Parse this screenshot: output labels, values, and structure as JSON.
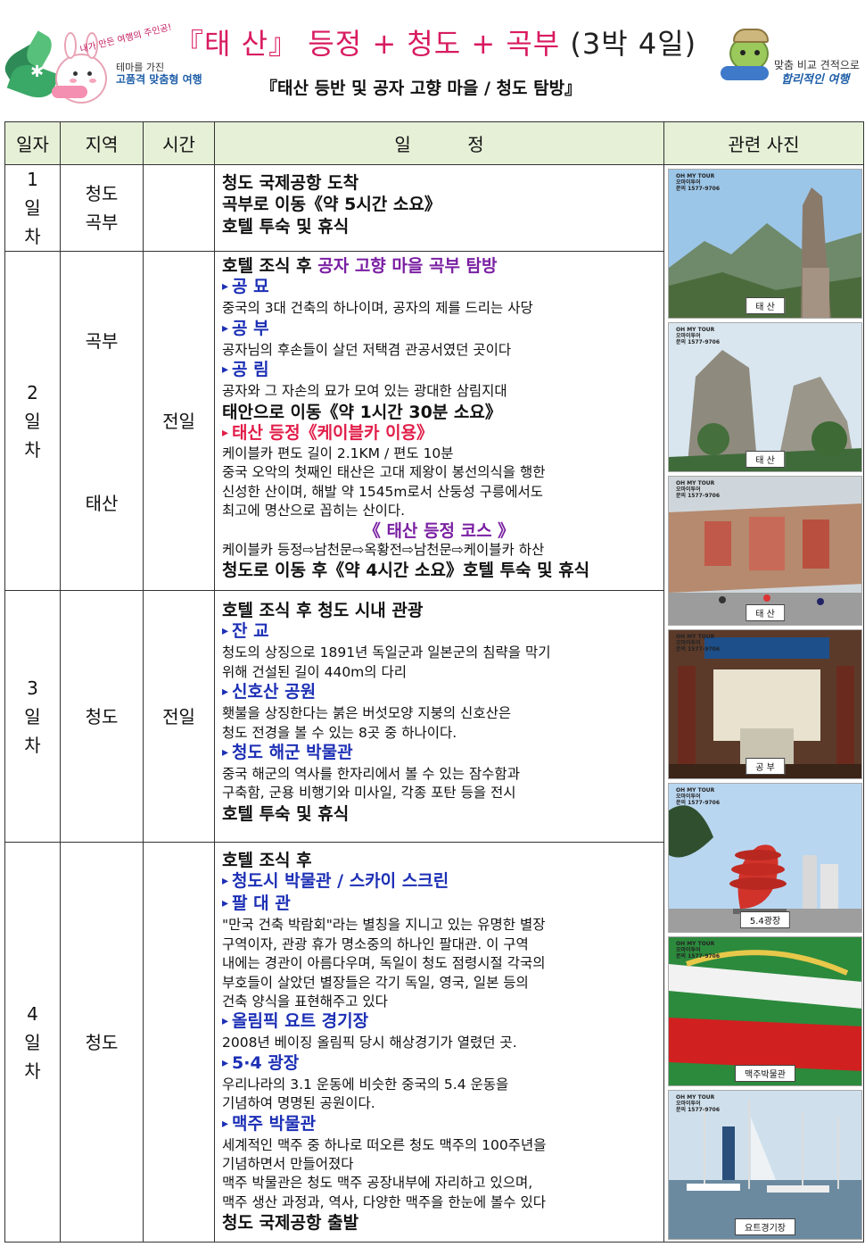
{
  "header": {
    "badge_text": "내가 만든 여행의 주인공!",
    "theme_line1": "테마를 가진",
    "theme_line2": "고품격 맞춤형 여행",
    "title_bracket_open": "『",
    "title_main": "태 산",
    "title_bracket_close": "』",
    "title_rest": "등정 + 청도 + 곡부",
    "title_duration": "(3박 4일)",
    "subtitle": "『태산 등반 및 공자 고향 마을 / 청도 탐방』",
    "right_line1": "맞춤 비교 견적으로",
    "right_line2": "합리적인 여행"
  },
  "table": {
    "headers": {
      "day": "일자",
      "region": "지역",
      "time": "시간",
      "schedule": "일          정",
      "photos": "관련 사진"
    },
    "days": [
      {
        "day": [
          "1",
          "일",
          "차"
        ],
        "regions": [
          "청도",
          "곡부"
        ],
        "time": "",
        "lines": [
          {
            "t": "b",
            "text": "청도 국제공항 도착"
          },
          {
            "t": "b",
            "text": "곡부로 이동《약 5시간 소요》"
          },
          {
            "t": "b",
            "text": "호텔 투숙 및 휴식"
          }
        ]
      },
      {
        "day": [
          "2",
          "일",
          "차"
        ],
        "region_a": "곡부",
        "region_b": "태산",
        "time": "전일",
        "lead_black": "호텔 조식 후 ",
        "lead_purple": "공자 고향 마을 곡부 탐방",
        "lines": [
          {
            "t": "h",
            "text": "공 묘"
          },
          {
            "t": "n",
            "text": "중국의 3대 건축의 하나이며, 공자의 제를 드리는 사당"
          },
          {
            "t": "h",
            "text": "공 부"
          },
          {
            "t": "n",
            "text": "공자님의 후손들이 살던 저택겸 관공서였던 곳이다"
          },
          {
            "t": "h",
            "text": "공 림"
          },
          {
            "t": "n",
            "text": "공자와 그 자손의 묘가 모여 있는 광대한 삼림지대"
          },
          {
            "t": "b",
            "text": "태안으로 이동《약 1시간 30분 소요》"
          },
          {
            "t": "r",
            "text": "태산 등정《케이블카 이용》"
          },
          {
            "t": "n",
            "text": "케이블카 편도 길이 2.1KM / 편도 10분"
          },
          {
            "t": "n",
            "text": "중국 오악의 첫째인 태산은 고대 제왕이 봉선의식을 행한"
          },
          {
            "t": "n",
            "text": "신성한 산이며, 해발 약 1545m로서 산둥성 구릉에서도"
          },
          {
            "t": "n",
            "text": "최고에 명산으로 꼽히는 산이다."
          },
          {
            "t": "ctr",
            "text": "《 태산 등정 코스 》"
          },
          {
            "t": "n",
            "text": "케이블카 등정⇨남천문⇨옥황전⇨남천문⇨케이블카 하산"
          },
          {
            "t": "b",
            "text": "청도로 이동 후《약 4시간 소요》호텔 투숙 및 휴식"
          }
        ]
      },
      {
        "day": [
          "3",
          "일",
          "차"
        ],
        "region": "청도",
        "time": "전일",
        "lines": [
          {
            "t": "b",
            "text": "호텔 조식 후 청도 시내 관광"
          },
          {
            "t": "h",
            "text": "잔 교"
          },
          {
            "t": "n",
            "text": "청도의 상징으로 1891년 독일군과 일본군의 침략을 막기"
          },
          {
            "t": "n",
            "text": "위해 건설된 길이 440m의 다리"
          },
          {
            "t": "h",
            "text": "신호산 공원"
          },
          {
            "t": "n",
            "text": "횃불을 상징한다는 붉은 버섯모양 지붕의 신호산은"
          },
          {
            "t": "n",
            "text": "청도 전경을 볼 수 있는 8곳 중 하나이다."
          },
          {
            "t": "h",
            "text": "청도 해군 박물관"
          },
          {
            "t": "n",
            "text": "중국 해군의 역사를 한자리에서 볼 수 있는 잠수함과"
          },
          {
            "t": "n",
            "text": "구축함, 군용 비행기와 미사일, 각종 포탄 등을 전시"
          },
          {
            "t": "b",
            "text": "호텔 투숙 및 휴식"
          }
        ]
      },
      {
        "day": [
          "4",
          "일",
          "차"
        ],
        "region": "청도",
        "time": "",
        "lines": [
          {
            "t": "b",
            "text": "호텔 조식 후"
          },
          {
            "t": "h",
            "text": "청도시 박물관 / 스카이 스크린"
          },
          {
            "t": "h",
            "text": "팔 대 관"
          },
          {
            "t": "n",
            "text": "\"만국 건축 박람회\"라는 별칭을 지니고 있는 유명한 별장"
          },
          {
            "t": "n",
            "text": "구역이자, 관광 휴가 명소중의 하나인 팔대관. 이 구역"
          },
          {
            "t": "n",
            "text": "내에는 경관이 아름다우며, 독일이 청도 점령시절 각국의"
          },
          {
            "t": "n",
            "text": "부호들이 살았던 별장들은 각기 독일, 영국, 일본 등의"
          },
          {
            "t": "n",
            "text": "건축 양식을 표현해주고 있다"
          },
          {
            "t": "h",
            "text": "올림픽 요트 경기장"
          },
          {
            "t": "n",
            "text": "2008년 베이징 올림픽 당시 해상경기가 열렸던 곳."
          },
          {
            "t": "h",
            "text": "5·4 광장"
          },
          {
            "t": "n",
            "text": "우리나라의 3.1 운동에 비슷한 중국의 5.4 운동을"
          },
          {
            "t": "n",
            "text": "기념하여 명명된 공원이다."
          },
          {
            "t": "h",
            "text": "맥주 박물관"
          },
          {
            "t": "n",
            "text": "세계적인 맥주 중 하나로 떠오른 청도 맥주의 100주년을"
          },
          {
            "t": "n",
            "text": "기념하면서 만들어졌다"
          },
          {
            "t": "n",
            "text": "맥주 박물관은 청도 맥주 공장내부에 자리하고 있으며,"
          },
          {
            "t": "n",
            "text": "맥주 생산 과정과, 역사, 다양한 맥주을 한눈에 볼수 있다"
          },
          {
            "t": "b",
            "text": "청도 국제공항 출발"
          }
        ]
      }
    ]
  },
  "photos": {
    "tag_line1": "OH MY TOUR",
    "tag_line2": "오마이투어",
    "tag_line3": "문의 1577-9706",
    "items": [
      {
        "caption": "태 산",
        "icon": "mountain-peak-photo"
      },
      {
        "caption": "태 산",
        "icon": "rock-cliff-photo"
      },
      {
        "caption": "태 산",
        "icon": "carved-cliff-photo"
      },
      {
        "caption": "공 부",
        "icon": "temple-hall-photo"
      },
      {
        "caption": "5.4광장",
        "icon": "red-sculpture-photo"
      },
      {
        "caption": "맥주박물관",
        "icon": "beer-can-photo"
      },
      {
        "caption": "요트경기장",
        "icon": "yacht-harbor-photo"
      }
    ]
  },
  "colors": {
    "header_bg": "#e6f0d7",
    "title_pink": "#d81b60",
    "heading_blue": "#1c2fb5",
    "highlight_red": "#e11d48",
    "purple": "#7a1fa2"
  }
}
